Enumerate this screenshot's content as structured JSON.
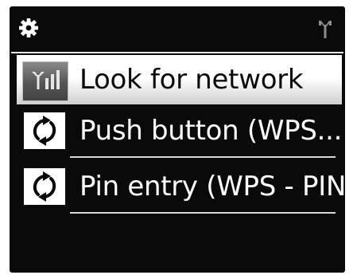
{
  "header": {
    "settings_icon": "gear-icon",
    "signal_icon": "antenna-signal-icon"
  },
  "menu": {
    "items": [
      {
        "label": "Look for network",
        "icon": "signal-strength-icon",
        "selected": true
      },
      {
        "label": "Push button (WPS...",
        "icon": "wps-arrows-icon",
        "selected": false
      },
      {
        "label": "Pin entry (WPS - PIN)",
        "icon": "wps-arrows-icon",
        "selected": false
      }
    ]
  },
  "colors": {
    "screen_bg": "#0a0a0a",
    "selected_bg": "#ffffff",
    "text": "#ffffff",
    "selected_text": "#0a0a0a",
    "icon_gray": "#9a9a9a"
  }
}
